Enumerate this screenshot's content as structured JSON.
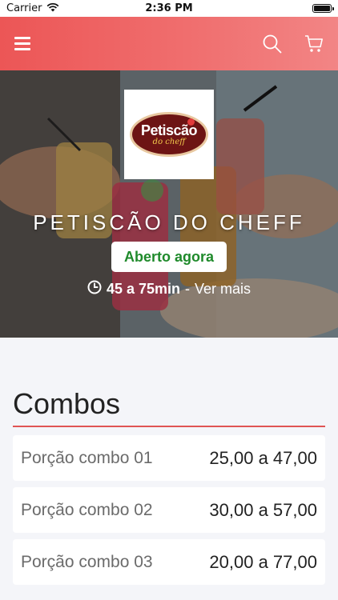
{
  "status_bar": {
    "carrier": "Carrier",
    "time": "2:36 PM",
    "icons": [
      "wifi-icon",
      "battery-icon"
    ]
  },
  "header": {
    "menu_icon": "hamburger-menu-icon",
    "search_icon": "search-icon",
    "cart_icon": "cart-icon",
    "background_color": "#ec5656"
  },
  "hero": {
    "logo": {
      "main_text": "Petiscão",
      "sub_text": "do cheff"
    },
    "restaurant_name": "PETISCÃO DO CHEFF",
    "status": "Aberto agora",
    "status_color": "#1f8a2b",
    "clock_icon": "clock-icon",
    "delivery_time": "45 a 75min",
    "separator": "-",
    "more_link": "Ver mais"
  },
  "menu": {
    "section_title": "Combos",
    "accent_color": "#e05454",
    "items": [
      {
        "name": "Porção combo 01",
        "price": "25,00 a 47,00"
      },
      {
        "name": "Porção combo 02",
        "price": "30,00 a 57,00"
      },
      {
        "name": "Porção combo 03",
        "price": "20,00 a 77,00"
      }
    ]
  }
}
